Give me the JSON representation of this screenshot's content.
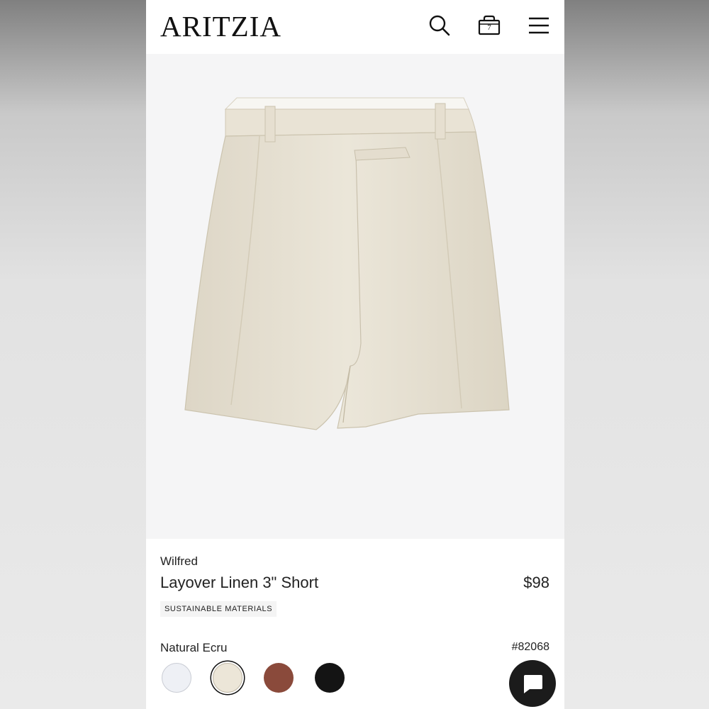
{
  "header": {
    "logo": "ARITZIA",
    "icons": [
      "search-icon",
      "shopping-bag-icon",
      "hamburger-menu-icon"
    ],
    "bag_count": "7"
  },
  "product": {
    "brand": "Wilfred",
    "name": "Layover Linen 3\" Short",
    "price": "$98",
    "badge": "SUSTAINABLE MATERIALS",
    "color_name": "Natural Ecru",
    "style_number": "#82068",
    "swatches": [
      {
        "name": "white",
        "color": "#eef0f5",
        "selected": false
      },
      {
        "name": "natural-ecru",
        "color": "#ece6d8",
        "selected": true
      },
      {
        "name": "brown",
        "color": "#8a4a3b",
        "selected": false
      },
      {
        "name": "black",
        "color": "#141414",
        "selected": false
      }
    ]
  },
  "colors": {
    "image_background": "#f5f5f6",
    "shorts_fabric": "#e8e2d4",
    "chat_button": "#1b1b1b"
  },
  "chat": {
    "icon": "chat-bubble-icon"
  }
}
